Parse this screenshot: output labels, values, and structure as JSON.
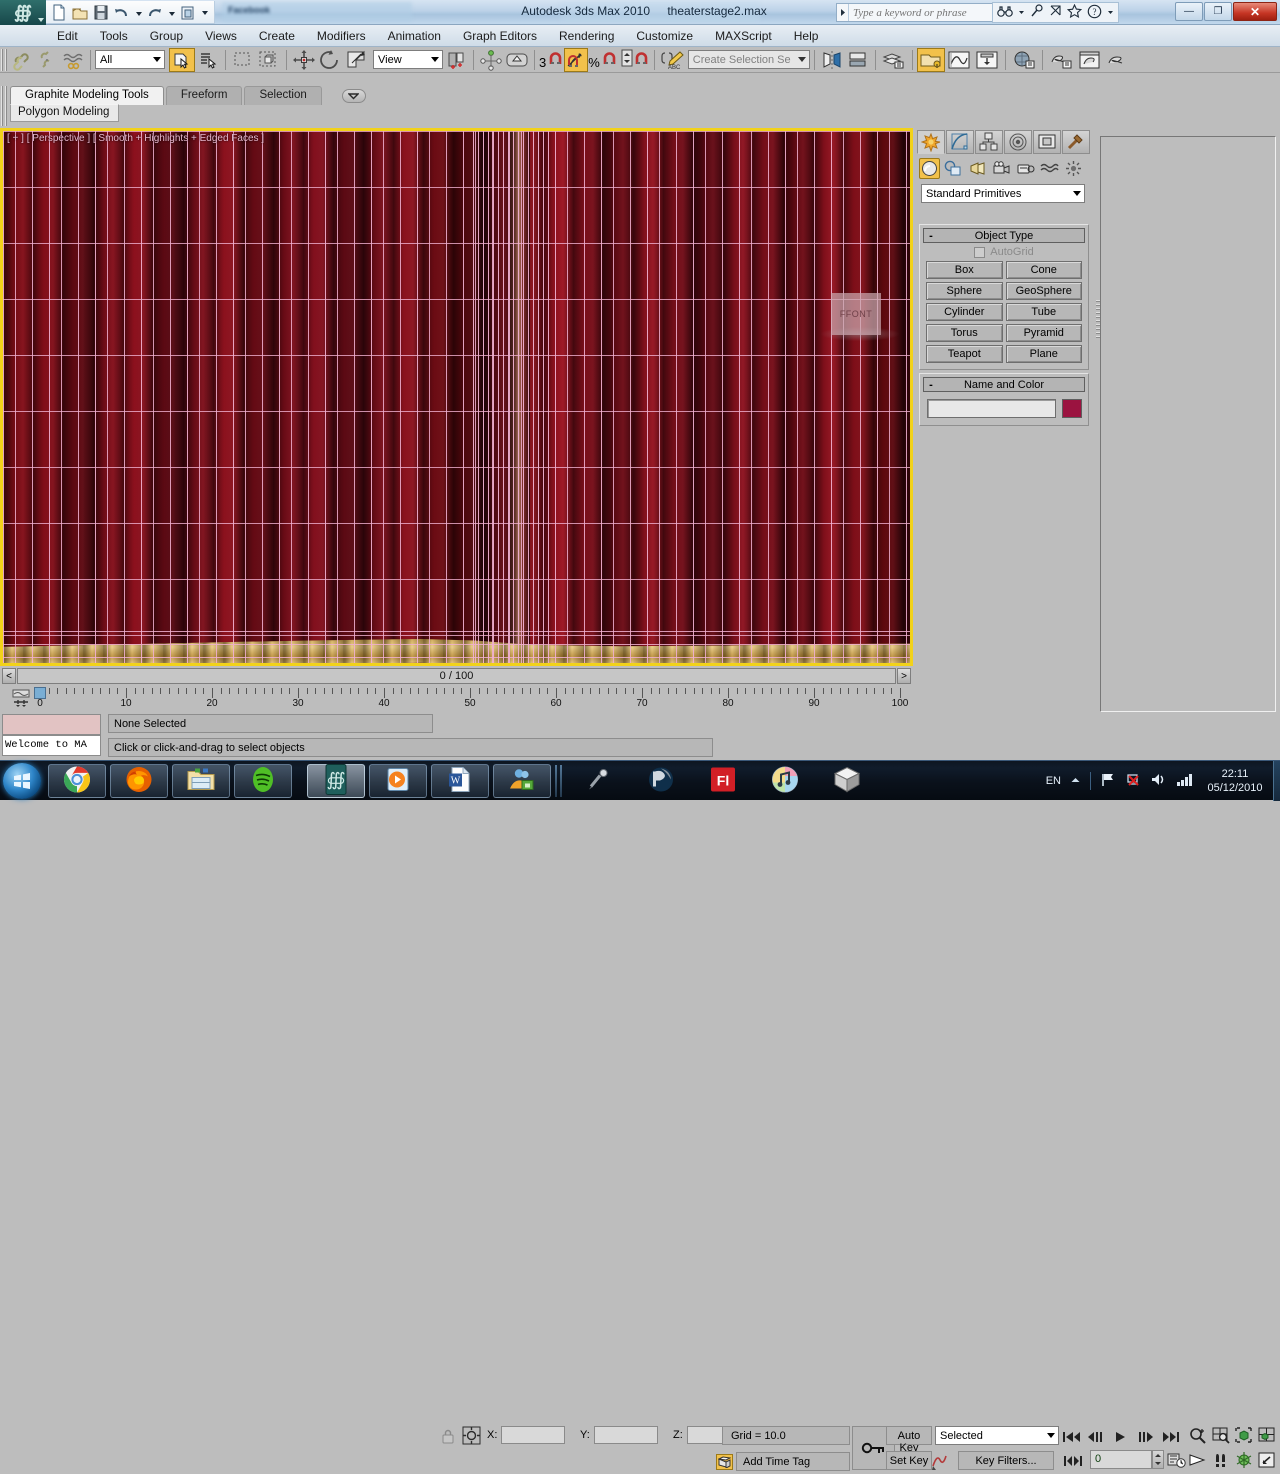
{
  "titlebar": {
    "app_title": "Autodesk 3ds Max  2010",
    "file_name": "theaterstage2.max",
    "ghost_window_title": "Facebook",
    "search_placeholder": "Type a keyword or phrase",
    "quick_access_icons": [
      "new-icon",
      "open-icon",
      "save-icon",
      "undo-icon",
      "redo-icon",
      "project-folder-icon",
      "customize-qat-icon"
    ],
    "help_icons": [
      "binoculars-icon",
      "pin-help-icon",
      "subscription-icon",
      "favorites-star-icon",
      "help-question-icon"
    ],
    "window_buttons": {
      "minimize": "—",
      "restore": "❐",
      "close": "✕"
    }
  },
  "menubar": {
    "items": [
      "Edit",
      "Tools",
      "Group",
      "Views",
      "Create",
      "Modifiers",
      "Animation",
      "Graph Editors",
      "Rendering",
      "Customize",
      "MAXScript",
      "Help"
    ]
  },
  "main_toolbar": {
    "selection_filter": "All",
    "reference_coord_system": "View",
    "named_selection_set_placeholder": "Create Selection Se",
    "angle_snap_value": "3",
    "percent_snap_label": "%",
    "icons": [
      "select-and-link-icon",
      "unlink-selection-icon",
      "bind-to-space-warp-icon",
      "select-object-icon",
      "select-by-name-icon",
      "rectangular-selection-region-icon",
      "window-crossing-icon",
      "select-and-move-icon",
      "select-and-rotate-icon",
      "select-and-uniform-scale-icon",
      "use-pivot-point-center-icon",
      "mirror-icon",
      "align-icon",
      "layer-manager-icon",
      "manage-scene-states-icon",
      "curve-editor-icon",
      "schematic-view-icon",
      "material-editor-icon",
      "render-setup-icon",
      "rendered-frame-window-icon",
      "render-production-icon"
    ]
  },
  "ribbon": {
    "tabs": [
      {
        "label": "Graphite Modeling Tools",
        "active": true
      },
      {
        "label": "Freeform",
        "active": false
      },
      {
        "label": "Selection",
        "active": false
      }
    ],
    "dropdown_icon": "chevron-down-icon",
    "panel_label": "Polygon Modeling"
  },
  "viewport": {
    "label": "[ + ] [ Perspective ] [ Smooth + Highlights + Edged Faces ]",
    "active_border_color": "#f2d21a",
    "wireframe_color": "#f0b0d0",
    "curtain_color": "#8e0c18",
    "curtain_shadow_color": "#3d060c",
    "band_color": "#d9a23e",
    "front_panel_label": "FFONT"
  },
  "time_slider": {
    "prev_frame": "<",
    "value": "0 / 100",
    "next_frame": ">"
  },
  "track_bar": {
    "icon": "open-mini-curve-editor-icon",
    "ticks": [
      0,
      10,
      20,
      30,
      40,
      50,
      60,
      70,
      80,
      90,
      100
    ],
    "current_frame": 0
  },
  "status": {
    "maxscript_listener_prompt": "Welcome to MA",
    "selection_status": "None Selected",
    "prompt_line": "Click or click-and-drag to select objects",
    "lock_icon": "selection-lock-icon",
    "xform_icon": "absolute-relative-transform-icon",
    "coords": [
      {
        "label": "X:",
        "value": ""
      },
      {
        "label": "Y:",
        "value": ""
      },
      {
        "label": "Z:",
        "value": ""
      }
    ],
    "grid_readout": "Grid = 10.0",
    "add_time_tag": "Add Time Tag",
    "time_tag_icon": "time-tag-icon",
    "key_mode_icon": "key-mode-toggle-icon"
  },
  "animation": {
    "auto_key": "Auto Key",
    "set_key": "Set Key",
    "key_filters": "Key Filters...",
    "key_mode_selected": "Selected",
    "frame_field": "0",
    "playback_icons": [
      "go-to-start-icon",
      "previous-frame-icon",
      "play-animation-icon",
      "next-frame-icon",
      "go-to-end-icon"
    ],
    "nav_icons_row1": [
      "zoom-icon",
      "zoom-all-icon",
      "zoom-extents-icon",
      "zoom-extents-all-icon"
    ],
    "nav_icons_row2": [
      "field-of-view-icon",
      "pan-view-icon",
      "orbit-icon",
      "maximize-viewport-toggle-icon"
    ],
    "set_key_curve_icon": "set-key-filters-curve-icon",
    "key_spinner_icon": "key-mode-toggle-icon",
    "time_config_icon": "time-configuration-icon"
  },
  "command_panel": {
    "tabs": [
      {
        "name": "create-tab",
        "icon": "star-create-icon",
        "active": true
      },
      {
        "name": "modify-tab",
        "icon": "modify-curve-icon",
        "active": false
      },
      {
        "name": "hierarchy-tab",
        "icon": "hierarchy-icon",
        "active": false
      },
      {
        "name": "motion-tab",
        "icon": "motion-icon",
        "active": false
      },
      {
        "name": "display-tab",
        "icon": "display-monitor-icon",
        "active": false
      },
      {
        "name": "utilities-tab",
        "icon": "utilities-hammer-icon",
        "active": false
      }
    ],
    "category_icons": [
      {
        "name": "geometry-icon",
        "active": true
      },
      {
        "name": "shapes-icon",
        "active": false
      },
      {
        "name": "lights-icon",
        "active": false
      },
      {
        "name": "cameras-icon",
        "active": false
      },
      {
        "name": "helpers-icon",
        "active": false
      },
      {
        "name": "space-warps-icon",
        "active": false
      },
      {
        "name": "systems-icon",
        "active": false
      }
    ],
    "subcategory": "Standard Primitives",
    "rollouts": [
      {
        "title": "Object Type",
        "minimize": "-",
        "autogrid_label": "AutoGrid",
        "autogrid_checked": false,
        "buttons": [
          "Box",
          "Cone",
          "Sphere",
          "GeoSphere",
          "Cylinder",
          "Tube",
          "Torus",
          "Pyramid",
          "Teapot",
          "Plane"
        ]
      },
      {
        "title": "Name and Color",
        "minimize": "-",
        "name_value": "",
        "color_swatch": "#9b1340"
      }
    ]
  },
  "taskbar": {
    "start_icon": "windows-start-orb-icon",
    "items": [
      {
        "name": "chrome-icon",
        "state": "open"
      },
      {
        "name": "firefox-icon",
        "state": "open"
      },
      {
        "name": "explorer-folder-icon",
        "state": "open"
      },
      {
        "name": "spotify-icon",
        "state": "open"
      },
      {
        "name": "3ds-max-icon",
        "state": "active"
      },
      {
        "name": "media-player-icon",
        "state": "open"
      },
      {
        "name": "word-icon",
        "state": "open"
      },
      {
        "name": "msn-messenger-icon",
        "state": "open"
      },
      {
        "name": "microphone-icon",
        "state": "pinned"
      },
      {
        "name": "photoshop-icon",
        "state": "pinned"
      },
      {
        "name": "flash-icon",
        "state": "pinned"
      },
      {
        "name": "itunes-icon",
        "state": "pinned"
      },
      {
        "name": "unity-icon",
        "state": "pinned"
      }
    ],
    "tray": {
      "language": "EN",
      "show_hidden_icon": "chevron-up-icon",
      "icons": [
        "flag-action-center-icon",
        "network-error-icon",
        "volume-icon",
        "signal-bars-icon"
      ],
      "time": "22:11",
      "date": "05/12/2010"
    }
  }
}
